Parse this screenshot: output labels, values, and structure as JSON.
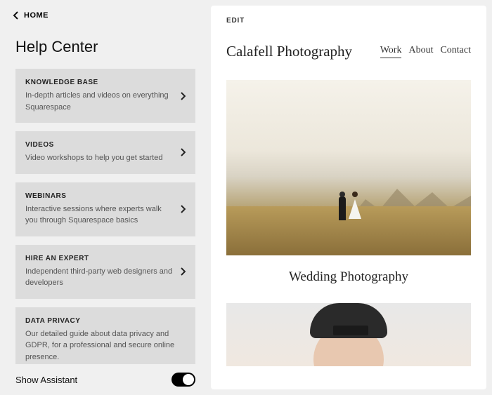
{
  "sidebar": {
    "home_label": "HOME",
    "help_title": "Help Center",
    "cards": [
      {
        "title": "KNOWLEDGE BASE",
        "desc": "In-depth articles and videos on everything Squarespace"
      },
      {
        "title": "VIDEOS",
        "desc": "Video workshops to help you get started"
      },
      {
        "title": "WEBINARS",
        "desc": "Interactive sessions where experts walk you through Squarespace basics"
      },
      {
        "title": "HIRE AN EXPERT",
        "desc": "Independent third-party web designers and developers"
      },
      {
        "title": "DATA PRIVACY",
        "desc": "Our detailed guide about data privacy and GDPR, for a professional and secure online presence."
      }
    ],
    "assistant_label": "Show Assistant"
  },
  "preview": {
    "edit_label": "EDIT",
    "site_title": "Calafell Photography",
    "nav": [
      {
        "label": "Work",
        "active": true
      },
      {
        "label": "About",
        "active": false
      },
      {
        "label": "Contact",
        "active": false
      }
    ],
    "caption": "Wedding Photography"
  }
}
